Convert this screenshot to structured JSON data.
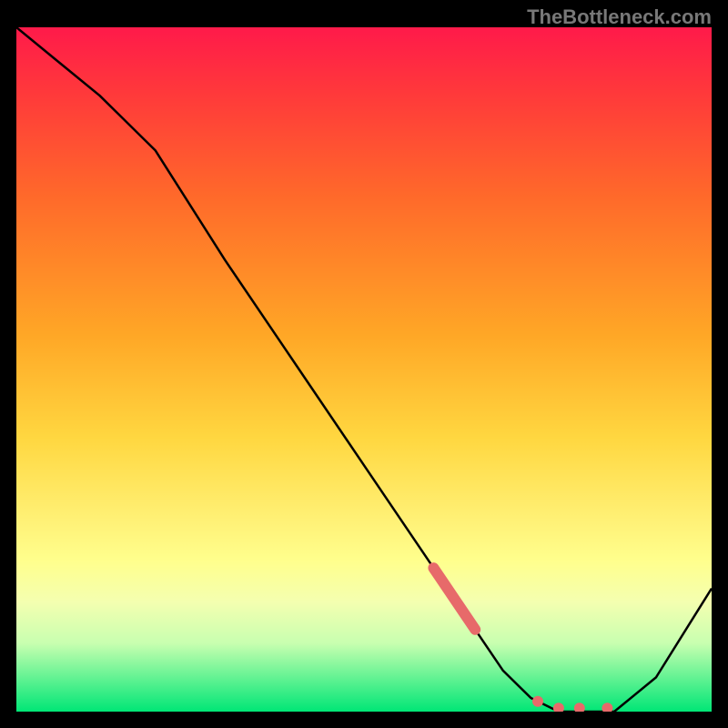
{
  "watermark": "TheBottleneck.com",
  "chart_data": {
    "type": "line",
    "title": "",
    "xlabel": "",
    "ylabel": "",
    "xlim": [
      0,
      100
    ],
    "ylim": [
      0,
      100
    ],
    "series": [
      {
        "name": "curve",
        "x": [
          0,
          6,
          12,
          20,
          30,
          40,
          50,
          60,
          66,
          70,
          74,
          78,
          82,
          86,
          92,
          100
        ],
        "y": [
          100,
          95,
          90,
          82,
          66,
          51,
          36,
          21,
          12,
          6,
          2,
          0,
          0,
          0,
          5,
          18
        ],
        "color": "#000000"
      }
    ],
    "markers": [
      {
        "name": "stroke-segment",
        "x": [
          60,
          66
        ],
        "y": [
          21,
          12
        ],
        "color": "#e76a6a",
        "width": 12
      },
      {
        "name": "dots",
        "points": [
          {
            "x": 75,
            "y": 1.5
          },
          {
            "x": 78,
            "y": 0.5
          },
          {
            "x": 81,
            "y": 0.5
          },
          {
            "x": 85,
            "y": 0.5
          }
        ],
        "color": "#e76a6a",
        "radius": 6
      }
    ],
    "background_gradient": {
      "top": "#ff1a4a",
      "bottom": "#00e676"
    }
  }
}
